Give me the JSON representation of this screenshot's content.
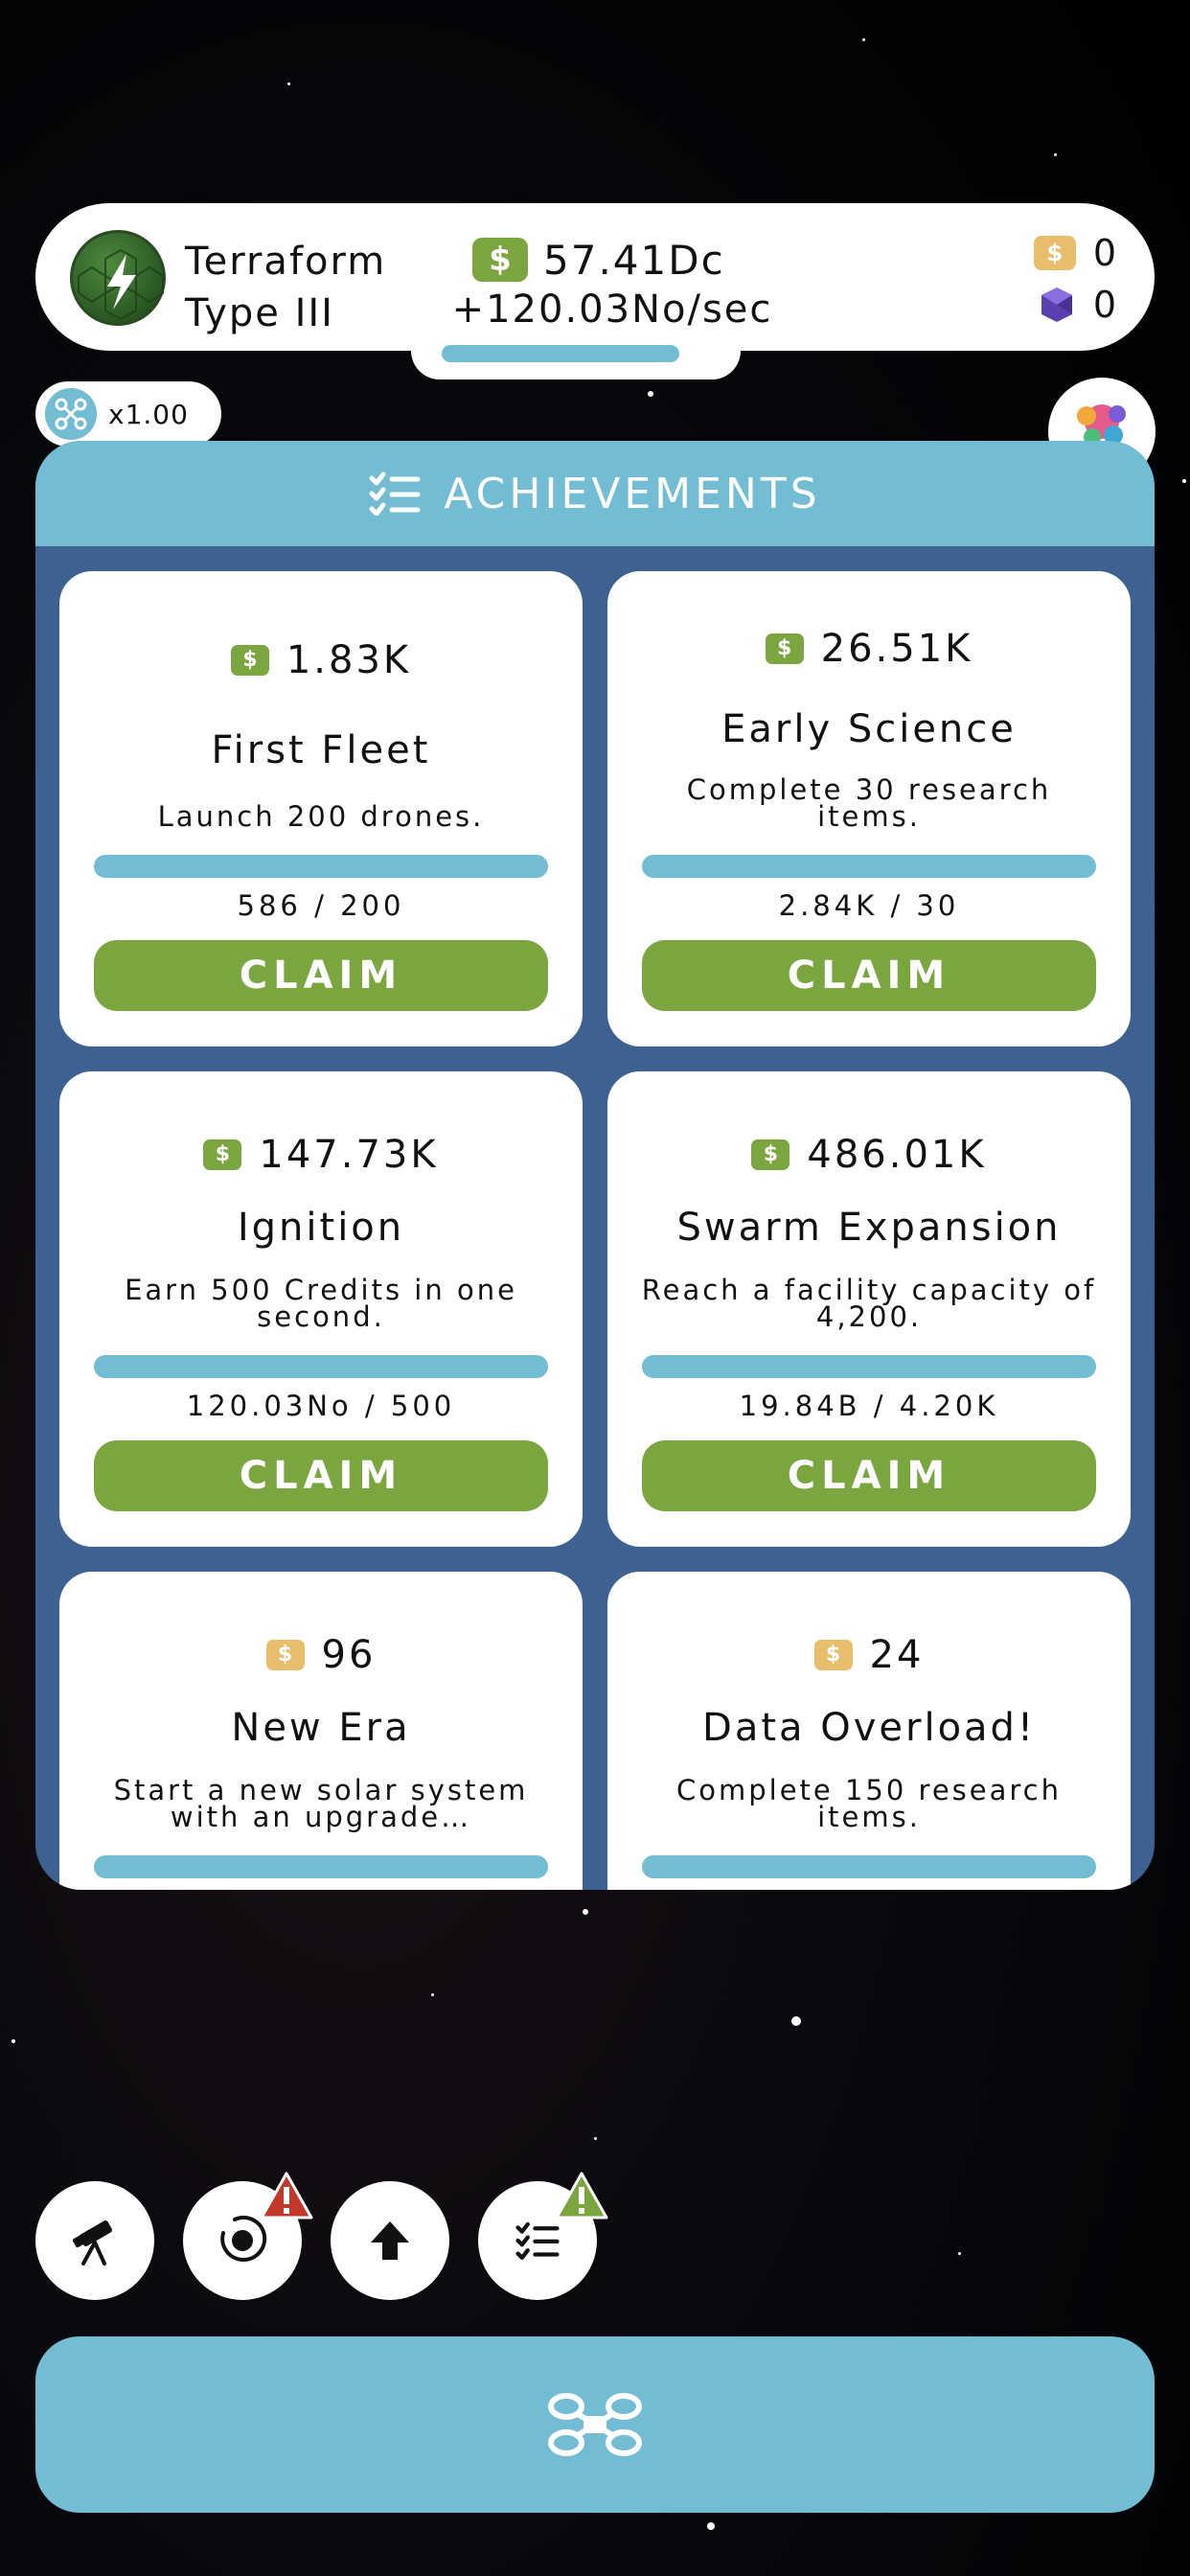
{
  "header": {
    "planet_name_line1": "Terraform",
    "planet_name_line2": "Type III",
    "money": "57.41Dc",
    "rate": "+120.03No/sec",
    "gold": "0",
    "gems": "0",
    "money_symbol": "$"
  },
  "multiplier": "x1.00",
  "panel": {
    "title": "ACHIEVEMENTS",
    "claim_label": "CLAIM",
    "cards": [
      {
        "reward": "1.83K",
        "title": "First Fleet",
        "desc": "Launch 200 drones.",
        "progress": "586 / 200",
        "claimable": true,
        "currency": "money"
      },
      {
        "reward": "26.51K",
        "title": "Early Science",
        "desc": "Complete 30 research items.",
        "progress": "2.84K / 30",
        "claimable": true,
        "currency": "money"
      },
      {
        "reward": "147.73K",
        "title": "Ignition",
        "desc": "Earn 500 Credits in one second.",
        "progress": "120.03No / 500",
        "claimable": true,
        "currency": "money"
      },
      {
        "reward": "486.01K",
        "title": "Swarm Expansion",
        "desc": "Reach a facility capacity of 4,200.",
        "progress": "19.84B / 4.20K",
        "claimable": true,
        "currency": "money"
      },
      {
        "reward": "96",
        "title": "New Era",
        "desc": "Start a new solar system with an upgrade…",
        "progress": "",
        "claimable": false,
        "currency": "gold"
      },
      {
        "reward": "24",
        "title": "Data Overload!",
        "desc": "Complete 150 research items.",
        "progress": "",
        "claimable": false,
        "currency": "gold"
      }
    ]
  },
  "colors": {
    "accent_blue": "#72bcd4",
    "claim_green": "#7aa53f",
    "panel_navy": "#3d6190",
    "gold": "#e8bd6c",
    "alert_red": "#c0392b",
    "alert_green": "#7aa53f"
  },
  "bottom_nav": [
    {
      "icon": "telescope-icon",
      "alert": false
    },
    {
      "icon": "orbit-icon",
      "alert": true,
      "alert_color": "red"
    },
    {
      "icon": "upgrade-arrow-icon",
      "alert": false
    },
    {
      "icon": "achievements-list-icon",
      "alert": true,
      "alert_color": "green"
    }
  ],
  "main_button_icon": "drone-icon"
}
